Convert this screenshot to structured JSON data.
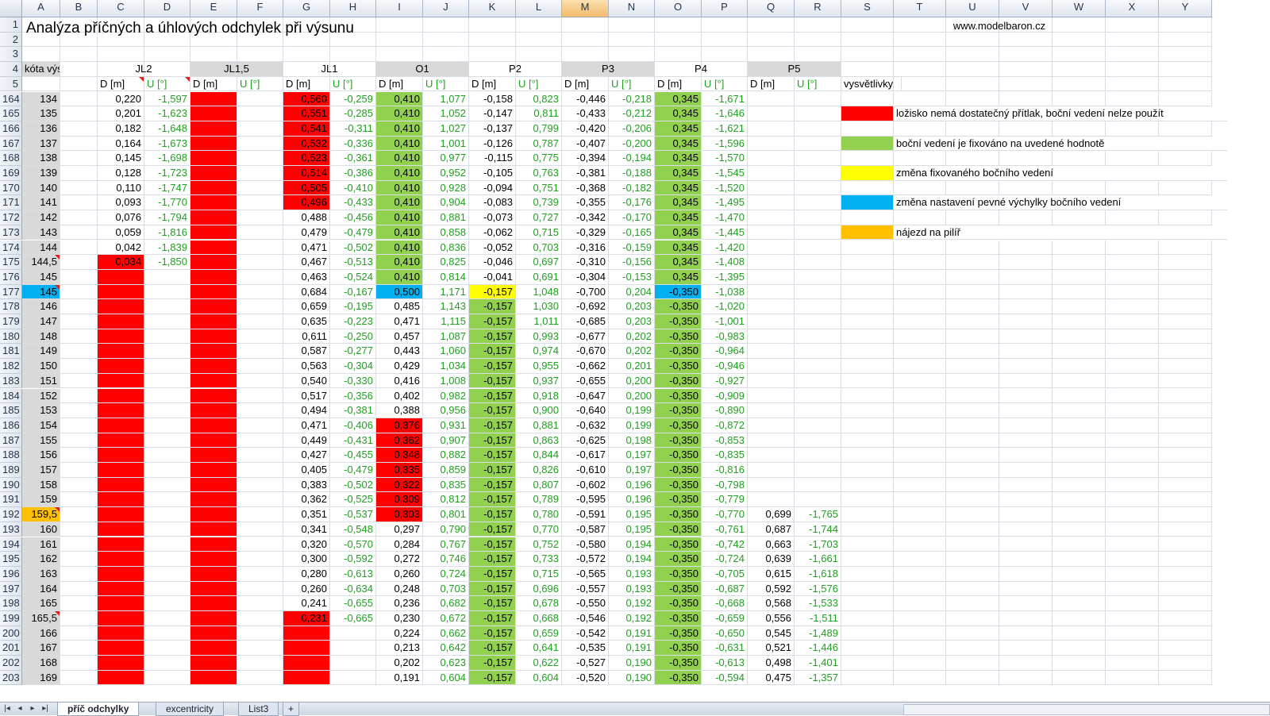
{
  "columns": [
    "A",
    "B",
    "C",
    "D",
    "E",
    "F",
    "G",
    "H",
    "I",
    "J",
    "K",
    "L",
    "M",
    "N",
    "O",
    "P",
    "Q",
    "R",
    "S",
    "T",
    "U",
    "V",
    "W",
    "X",
    "Y"
  ],
  "selected_column": "M",
  "title": "Analýza příčných a úhlových odchylek při výsunu",
  "website": "www.modelbaron.cz",
  "header_row4": {
    "kota": "kóta výsunu",
    "groups": [
      "JL2",
      "JL1,5",
      "JL1",
      "O1",
      "P2",
      "P3",
      "P4",
      "P5"
    ]
  },
  "sublabels": {
    "d": "D [m]",
    "u": "U [°]"
  },
  "legend_title": "vysvětlivky",
  "legend": [
    {
      "color": "#ff0000",
      "text": "ložisko nemá dostatečný přítlak, boční vedení nelze použít"
    },
    {
      "color": "#92d050",
      "text": "boční vedení je fixováno na uvedené hodnotě"
    },
    {
      "color": "#ffff00",
      "text": "změna fixovaného bočního vedení"
    },
    {
      "color": "#00b0f0",
      "text": "změna nastavení pevné výchylky bočního vedení"
    },
    {
      "color": "#ffc000",
      "text": "nájezd na pilíř"
    }
  ],
  "colors": {
    "red": "#ff0000",
    "green": "#92d050",
    "yellow": "#ffff00",
    "blue": "#00b0f0",
    "orange": "#ffc000",
    "green_text": "#20a020"
  },
  "tabs": [
    "příč odchylky",
    "excentricity",
    "List3"
  ],
  "rows": [
    {
      "n": "164",
      "a": "134",
      "jl2": [
        "0,220",
        "-1,597"
      ],
      "jl1": [
        "0,560",
        "-0,259"
      ],
      "o1": [
        "0,410",
        "1,077"
      ],
      "p2": [
        "-0,158",
        "0,823"
      ],
      "p3": [
        "-0,446",
        "-0,218"
      ],
      "p4": [
        "0,345",
        "-1,671"
      ],
      "p5": [
        "",
        ""
      ]
    },
    {
      "n": "165",
      "a": "135",
      "jl2": [
        "0,201",
        "-1,623"
      ],
      "jl1": [
        "0,551",
        "-0,285"
      ],
      "o1": [
        "0,410",
        "1,052"
      ],
      "p2": [
        "-0,147",
        "0,811"
      ],
      "p3": [
        "-0,433",
        "-0,212"
      ],
      "p4": [
        "0,345",
        "-1,646"
      ],
      "p5": [
        "",
        ""
      ]
    },
    {
      "n": "166",
      "a": "136",
      "jl2": [
        "0,182",
        "-1,648"
      ],
      "jl1": [
        "0,541",
        "-0,311"
      ],
      "o1": [
        "0,410",
        "1,027"
      ],
      "p2": [
        "-0,137",
        "0,799"
      ],
      "p3": [
        "-0,420",
        "-0,206"
      ],
      "p4": [
        "0,345",
        "-1,621"
      ],
      "p5": [
        "",
        ""
      ]
    },
    {
      "n": "167",
      "a": "137",
      "jl2": [
        "0,164",
        "-1,673"
      ],
      "jl1": [
        "0,532",
        "-0,336"
      ],
      "o1": [
        "0,410",
        "1,001"
      ],
      "p2": [
        "-0,126",
        "0,787"
      ],
      "p3": [
        "-0,407",
        "-0,200"
      ],
      "p4": [
        "0,345",
        "-1,596"
      ],
      "p5": [
        "",
        ""
      ]
    },
    {
      "n": "168",
      "a": "138",
      "jl2": [
        "0,145",
        "-1,698"
      ],
      "jl1": [
        "0,523",
        "-0,361"
      ],
      "o1": [
        "0,410",
        "0,977"
      ],
      "p2": [
        "-0,115",
        "0,775"
      ],
      "p3": [
        "-0,394",
        "-0,194"
      ],
      "p4": [
        "0,345",
        "-1,570"
      ],
      "p5": [
        "",
        ""
      ]
    },
    {
      "n": "169",
      "a": "139",
      "jl2": [
        "0,128",
        "-1,723"
      ],
      "jl1": [
        "0,514",
        "-0,386"
      ],
      "o1": [
        "0,410",
        "0,952"
      ],
      "p2": [
        "-0,105",
        "0,763"
      ],
      "p3": [
        "-0,381",
        "-0,188"
      ],
      "p4": [
        "0,345",
        "-1,545"
      ],
      "p5": [
        "",
        ""
      ]
    },
    {
      "n": "170",
      "a": "140",
      "jl2": [
        "0,110",
        "-1,747"
      ],
      "jl1": [
        "0,505",
        "-0,410"
      ],
      "o1": [
        "0,410",
        "0,928"
      ],
      "p2": [
        "-0,094",
        "0,751"
      ],
      "p3": [
        "-0,368",
        "-0,182"
      ],
      "p4": [
        "0,345",
        "-1,520"
      ],
      "p5": [
        "",
        ""
      ]
    },
    {
      "n": "171",
      "a": "141",
      "jl2": [
        "0,093",
        "-1,770"
      ],
      "jl1": [
        "0,496",
        "-0,433"
      ],
      "o1": [
        "0,410",
        "0,904"
      ],
      "p2": [
        "-0,083",
        "0,739"
      ],
      "p3": [
        "-0,355",
        "-0,176"
      ],
      "p4": [
        "0,345",
        "-1,495"
      ],
      "p5": [
        "",
        ""
      ]
    },
    {
      "n": "172",
      "a": "142",
      "jl2": [
        "0,076",
        "-1,794"
      ],
      "jl1": [
        "0,488",
        "-0,456"
      ],
      "o1": [
        "0,410",
        "0,881"
      ],
      "p2": [
        "-0,073",
        "0,727"
      ],
      "p3": [
        "-0,342",
        "-0,170"
      ],
      "p4": [
        "0,345",
        "-1,470"
      ],
      "p5": [
        "",
        ""
      ]
    },
    {
      "n": "173",
      "a": "143",
      "jl2": [
        "0,059",
        "-1,816"
      ],
      "jl1": [
        "0,479",
        "-0,479"
      ],
      "o1": [
        "0,410",
        "0,858"
      ],
      "p2": [
        "-0,062",
        "0,715"
      ],
      "p3": [
        "-0,329",
        "-0,165"
      ],
      "p4": [
        "0,345",
        "-1,445"
      ],
      "p5": [
        "",
        ""
      ]
    },
    {
      "n": "174",
      "a": "144",
      "jl2": [
        "0,042",
        "-1,839"
      ],
      "jl1": [
        "0,471",
        "-0,502"
      ],
      "o1": [
        "0,410",
        "0,836"
      ],
      "p2": [
        "-0,052",
        "0,703"
      ],
      "p3": [
        "-0,316",
        "-0,159"
      ],
      "p4": [
        "0,345",
        "-1,420"
      ],
      "p5": [
        "",
        ""
      ]
    },
    {
      "n": "175",
      "a": "144,5",
      "jl2": [
        "0,034",
        "-1,850"
      ],
      "jl1": [
        "0,467",
        "-0,513"
      ],
      "o1": [
        "0,410",
        "0,825"
      ],
      "p2": [
        "-0,046",
        "0,697"
      ],
      "p3": [
        "-0,310",
        "-0,156"
      ],
      "p4": [
        "0,345",
        "-1,408"
      ],
      "p5": [
        "",
        ""
      ]
    },
    {
      "n": "176",
      "a": "145",
      "jl2": [
        "",
        ""
      ],
      "jl1": [
        "0,463",
        "-0,524"
      ],
      "o1": [
        "0,410",
        "0,814"
      ],
      "p2": [
        "-0,041",
        "0,691"
      ],
      "p3": [
        "-0,304",
        "-0,153"
      ],
      "p4": [
        "0,345",
        "-1,395"
      ],
      "p5": [
        "",
        ""
      ]
    },
    {
      "n": "177",
      "a": "145",
      "jl2": [
        "",
        ""
      ],
      "jl1": [
        "0,684",
        "-0,167"
      ],
      "o1": [
        "0,500",
        "1,171"
      ],
      "p2": [
        "-0,157",
        "1,048"
      ],
      "p3": [
        "-0,700",
        "0,204"
      ],
      "p4": [
        "-0,350",
        "-1,038"
      ],
      "p5": [
        "",
        ""
      ]
    },
    {
      "n": "178",
      "a": "146",
      "jl2": [
        "",
        ""
      ],
      "jl1": [
        "0,659",
        "-0,195"
      ],
      "o1": [
        "0,485",
        "1,143"
      ],
      "p2": [
        "-0,157",
        "1,030"
      ],
      "p3": [
        "-0,692",
        "0,203"
      ],
      "p4": [
        "-0,350",
        "-1,020"
      ],
      "p5": [
        "",
        ""
      ]
    },
    {
      "n": "179",
      "a": "147",
      "jl2": [
        "",
        ""
      ],
      "jl1": [
        "0,635",
        "-0,223"
      ],
      "o1": [
        "0,471",
        "1,115"
      ],
      "p2": [
        "-0,157",
        "1,011"
      ],
      "p3": [
        "-0,685",
        "0,203"
      ],
      "p4": [
        "-0,350",
        "-1,001"
      ],
      "p5": [
        "",
        ""
      ]
    },
    {
      "n": "180",
      "a": "148",
      "jl2": [
        "",
        ""
      ],
      "jl1": [
        "0,611",
        "-0,250"
      ],
      "o1": [
        "0,457",
        "1,087"
      ],
      "p2": [
        "-0,157",
        "0,993"
      ],
      "p3": [
        "-0,677",
        "0,202"
      ],
      "p4": [
        "-0,350",
        "-0,983"
      ],
      "p5": [
        "",
        ""
      ]
    },
    {
      "n": "181",
      "a": "149",
      "jl2": [
        "",
        ""
      ],
      "jl1": [
        "0,587",
        "-0,277"
      ],
      "o1": [
        "0,443",
        "1,060"
      ],
      "p2": [
        "-0,157",
        "0,974"
      ],
      "p3": [
        "-0,670",
        "0,202"
      ],
      "p4": [
        "-0,350",
        "-0,964"
      ],
      "p5": [
        "",
        ""
      ]
    },
    {
      "n": "182",
      "a": "150",
      "jl2": [
        "",
        ""
      ],
      "jl1": [
        "0,563",
        "-0,304"
      ],
      "o1": [
        "0,429",
        "1,034"
      ],
      "p2": [
        "-0,157",
        "0,955"
      ],
      "p3": [
        "-0,662",
        "0,201"
      ],
      "p4": [
        "-0,350",
        "-0,946"
      ],
      "p5": [
        "",
        ""
      ]
    },
    {
      "n": "183",
      "a": "151",
      "jl2": [
        "",
        ""
      ],
      "jl1": [
        "0,540",
        "-0,330"
      ],
      "o1": [
        "0,416",
        "1,008"
      ],
      "p2": [
        "-0,157",
        "0,937"
      ],
      "p3": [
        "-0,655",
        "0,200"
      ],
      "p4": [
        "-0,350",
        "-0,927"
      ],
      "p5": [
        "",
        ""
      ]
    },
    {
      "n": "184",
      "a": "152",
      "jl2": [
        "",
        ""
      ],
      "jl1": [
        "0,517",
        "-0,356"
      ],
      "o1": [
        "0,402",
        "0,982"
      ],
      "p2": [
        "-0,157",
        "0,918"
      ],
      "p3": [
        "-0,647",
        "0,200"
      ],
      "p4": [
        "-0,350",
        "-0,909"
      ],
      "p5": [
        "",
        ""
      ]
    },
    {
      "n": "185",
      "a": "153",
      "jl2": [
        "",
        ""
      ],
      "jl1": [
        "0,494",
        "-0,381"
      ],
      "o1": [
        "0,388",
        "0,956"
      ],
      "p2": [
        "-0,157",
        "0,900"
      ],
      "p3": [
        "-0,640",
        "0,199"
      ],
      "p4": [
        "-0,350",
        "-0,890"
      ],
      "p5": [
        "",
        ""
      ]
    },
    {
      "n": "186",
      "a": "154",
      "jl2": [
        "",
        ""
      ],
      "jl1": [
        "0,471",
        "-0,406"
      ],
      "o1": [
        "0,376",
        "0,931"
      ],
      "p2": [
        "-0,157",
        "0,881"
      ],
      "p3": [
        "-0,632",
        "0,199"
      ],
      "p4": [
        "-0,350",
        "-0,872"
      ],
      "p5": [
        "",
        ""
      ]
    },
    {
      "n": "187",
      "a": "155",
      "jl2": [
        "",
        ""
      ],
      "jl1": [
        "0,449",
        "-0,431"
      ],
      "o1": [
        "0,362",
        "0,907"
      ],
      "p2": [
        "-0,157",
        "0,863"
      ],
      "p3": [
        "-0,625",
        "0,198"
      ],
      "p4": [
        "-0,350",
        "-0,853"
      ],
      "p5": [
        "",
        ""
      ]
    },
    {
      "n": "188",
      "a": "156",
      "jl2": [
        "",
        ""
      ],
      "jl1": [
        "0,427",
        "-0,455"
      ],
      "o1": [
        "0,348",
        "0,882"
      ],
      "p2": [
        "-0,157",
        "0,844"
      ],
      "p3": [
        "-0,617",
        "0,197"
      ],
      "p4": [
        "-0,350",
        "-0,835"
      ],
      "p5": [
        "",
        ""
      ]
    },
    {
      "n": "189",
      "a": "157",
      "jl2": [
        "",
        ""
      ],
      "jl1": [
        "0,405",
        "-0,479"
      ],
      "o1": [
        "0,335",
        "0,859"
      ],
      "p2": [
        "-0,157",
        "0,826"
      ],
      "p3": [
        "-0,610",
        "0,197"
      ],
      "p4": [
        "-0,350",
        "-0,816"
      ],
      "p5": [
        "",
        ""
      ]
    },
    {
      "n": "190",
      "a": "158",
      "jl2": [
        "",
        ""
      ],
      "jl1": [
        "0,383",
        "-0,502"
      ],
      "o1": [
        "0,322",
        "0,835"
      ],
      "p2": [
        "-0,157",
        "0,807"
      ],
      "p3": [
        "-0,602",
        "0,196"
      ],
      "p4": [
        "-0,350",
        "-0,798"
      ],
      "p5": [
        "",
        ""
      ]
    },
    {
      "n": "191",
      "a": "159",
      "jl2": [
        "",
        ""
      ],
      "jl1": [
        "0,362",
        "-0,525"
      ],
      "o1": [
        "0,309",
        "0,812"
      ],
      "p2": [
        "-0,157",
        "0,789"
      ],
      "p3": [
        "-0,595",
        "0,196"
      ],
      "p4": [
        "-0,350",
        "-0,779"
      ],
      "p5": [
        "",
        ""
      ]
    },
    {
      "n": "192",
      "a": "159,5",
      "jl2": [
        "",
        ""
      ],
      "jl1": [
        "0,351",
        "-0,537"
      ],
      "o1": [
        "0,303",
        "0,801"
      ],
      "p2": [
        "-0,157",
        "0,780"
      ],
      "p3": [
        "-0,591",
        "0,195"
      ],
      "p4": [
        "-0,350",
        "-0,770"
      ],
      "p5": [
        "0,699",
        "-1,765"
      ]
    },
    {
      "n": "193",
      "a": "160",
      "jl2": [
        "",
        ""
      ],
      "jl1": [
        "0,341",
        "-0,548"
      ],
      "o1": [
        "0,297",
        "0,790"
      ],
      "p2": [
        "-0,157",
        "0,770"
      ],
      "p3": [
        "-0,587",
        "0,195"
      ],
      "p4": [
        "-0,350",
        "-0,761"
      ],
      "p5": [
        "0,687",
        "-1,744"
      ]
    },
    {
      "n": "194",
      "a": "161",
      "jl2": [
        "",
        ""
      ],
      "jl1": [
        "0,320",
        "-0,570"
      ],
      "o1": [
        "0,284",
        "0,767"
      ],
      "p2": [
        "-0,157",
        "0,752"
      ],
      "p3": [
        "-0,580",
        "0,194"
      ],
      "p4": [
        "-0,350",
        "-0,742"
      ],
      "p5": [
        "0,663",
        "-1,703"
      ]
    },
    {
      "n": "195",
      "a": "162",
      "jl2": [
        "",
        ""
      ],
      "jl1": [
        "0,300",
        "-0,592"
      ],
      "o1": [
        "0,272",
        "0,746"
      ],
      "p2": [
        "-0,157",
        "0,733"
      ],
      "p3": [
        "-0,572",
        "0,194"
      ],
      "p4": [
        "-0,350",
        "-0,724"
      ],
      "p5": [
        "0,639",
        "-1,661"
      ]
    },
    {
      "n": "196",
      "a": "163",
      "jl2": [
        "",
        ""
      ],
      "jl1": [
        "0,280",
        "-0,613"
      ],
      "o1": [
        "0,260",
        "0,724"
      ],
      "p2": [
        "-0,157",
        "0,715"
      ],
      "p3": [
        "-0,565",
        "0,193"
      ],
      "p4": [
        "-0,350",
        "-0,705"
      ],
      "p5": [
        "0,615",
        "-1,618"
      ]
    },
    {
      "n": "197",
      "a": "164",
      "jl2": [
        "",
        ""
      ],
      "jl1": [
        "0,260",
        "-0,634"
      ],
      "o1": [
        "0,248",
        "0,703"
      ],
      "p2": [
        "-0,157",
        "0,696"
      ],
      "p3": [
        "-0,557",
        "0,193"
      ],
      "p4": [
        "-0,350",
        "-0,687"
      ],
      "p5": [
        "0,592",
        "-1,576"
      ]
    },
    {
      "n": "198",
      "a": "165",
      "jl2": [
        "",
        ""
      ],
      "jl1": [
        "0,241",
        "-0,655"
      ],
      "o1": [
        "0,236",
        "0,682"
      ],
      "p2": [
        "-0,157",
        "0,678"
      ],
      "p3": [
        "-0,550",
        "0,192"
      ],
      "p4": [
        "-0,350",
        "-0,668"
      ],
      "p5": [
        "0,568",
        "-1,533"
      ]
    },
    {
      "n": "199",
      "a": "165,5",
      "jl2": [
        "",
        ""
      ],
      "jl1": [
        "0,231",
        "-0,665"
      ],
      "o1": [
        "0,230",
        "0,672"
      ],
      "p2": [
        "-0,157",
        "0,668"
      ],
      "p3": [
        "-0,546",
        "0,192"
      ],
      "p4": [
        "-0,350",
        "-0,659"
      ],
      "p5": [
        "0,556",
        "-1,511"
      ]
    },
    {
      "n": "200",
      "a": "166",
      "jl2": [
        "",
        ""
      ],
      "jl1": [
        "",
        ""
      ],
      "o1": [
        "0,224",
        "0,662"
      ],
      "p2": [
        "-0,157",
        "0,659"
      ],
      "p3": [
        "-0,542",
        "0,191"
      ],
      "p4": [
        "-0,350",
        "-0,650"
      ],
      "p5": [
        "0,545",
        "-1,489"
      ]
    },
    {
      "n": "201",
      "a": "167",
      "jl2": [
        "",
        ""
      ],
      "jl1": [
        "",
        ""
      ],
      "o1": [
        "0,213",
        "0,642"
      ],
      "p2": [
        "-0,157",
        "0,641"
      ],
      "p3": [
        "-0,535",
        "0,191"
      ],
      "p4": [
        "-0,350",
        "-0,631"
      ],
      "p5": [
        "0,521",
        "-1,446"
      ]
    },
    {
      "n": "202",
      "a": "168",
      "jl2": [
        "",
        ""
      ],
      "jl1": [
        "",
        ""
      ],
      "o1": [
        "0,202",
        "0,623"
      ],
      "p2": [
        "-0,157",
        "0,622"
      ],
      "p3": [
        "-0,527",
        "0,190"
      ],
      "p4": [
        "-0,350",
        "-0,613"
      ],
      "p5": [
        "0,498",
        "-1,401"
      ]
    },
    {
      "n": "203",
      "a": "169",
      "jl2": [
        "",
        ""
      ],
      "jl1": [
        "",
        ""
      ],
      "o1": [
        "0,191",
        "0,604"
      ],
      "p2": [
        "-0,157",
        "0,604"
      ],
      "p3": [
        "-0,520",
        "0,190"
      ],
      "p4": [
        "-0,350",
        "-0,594"
      ],
      "p5": [
        "0,475",
        "-1,357"
      ]
    }
  ]
}
